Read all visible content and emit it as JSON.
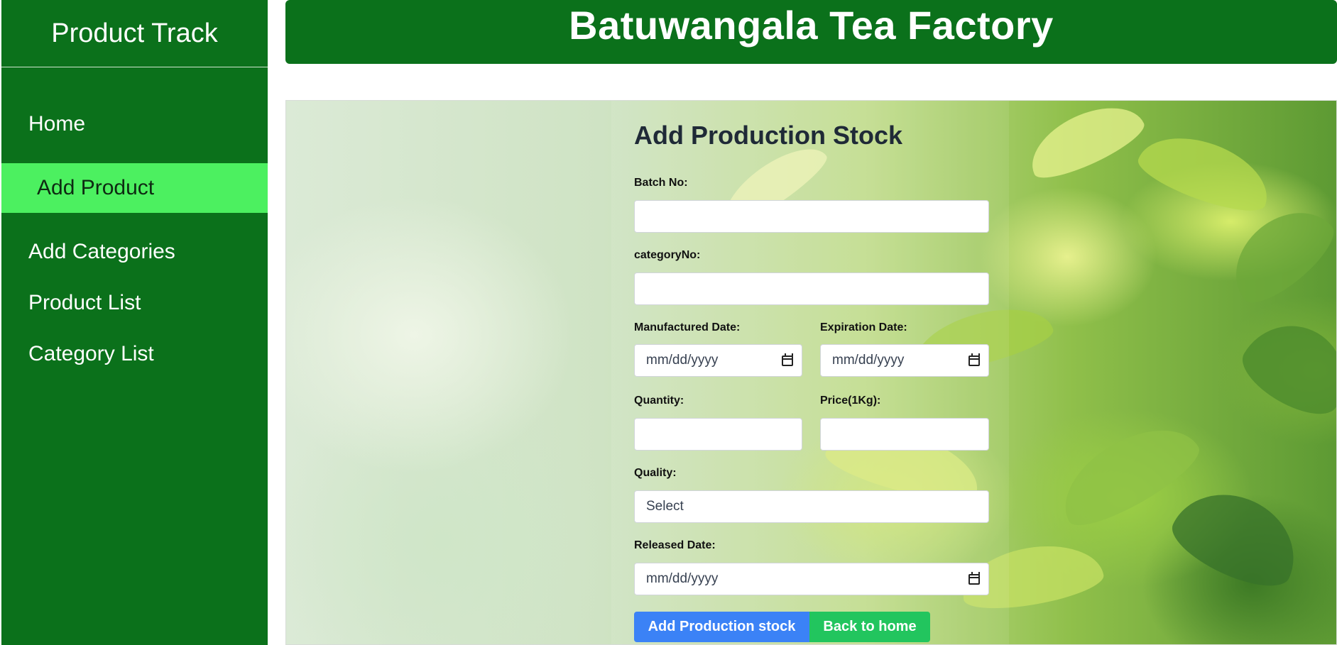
{
  "sidebar": {
    "brand": "Product Track",
    "items": [
      {
        "label": "Home"
      },
      {
        "label": "Add Product"
      },
      {
        "label": "Add Categories"
      },
      {
        "label": "Product List"
      },
      {
        "label": "Category List"
      }
    ]
  },
  "header": {
    "title": "Batuwangala Tea Factory"
  },
  "form": {
    "title": "Add Production Stock",
    "batch_label": "Batch No:",
    "category_label": "categoryNo:",
    "manufactured_label": "Manufactured Date:",
    "manufactured_value": "mm/dd/yyyy",
    "expiration_label": "Expiration Date:",
    "expiration_value": "mm/dd/yyyy",
    "quantity_label": "Quantity:",
    "price_label": "Price(1Kg):",
    "quality_label": "Quality:",
    "quality_value": "Select",
    "released_label": "Released Date:",
    "released_value": "mm/dd/yyyy",
    "submit_label": "Add Production stock",
    "back_label": "Back to home"
  },
  "colors": {
    "sidebar_bg": "#0b711b",
    "active_item_bg": "#4cf060",
    "primary_button": "#3b82f6",
    "secondary_button": "#22c55e"
  }
}
